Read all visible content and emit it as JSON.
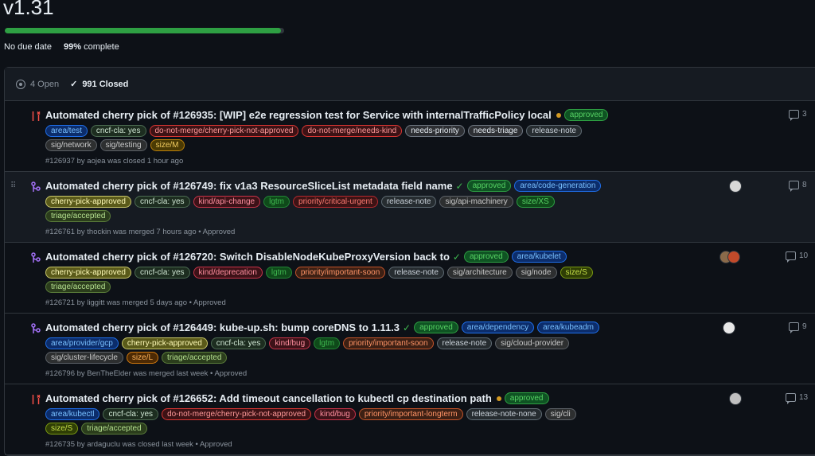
{
  "milestone": {
    "title": "v1.31",
    "progress": 0.99,
    "due": "No due date",
    "percent": "99%",
    "complete_label": "complete"
  },
  "list_header": {
    "open": "4 Open",
    "closed": "991 Closed"
  },
  "colors": {
    "closed_icon": "#f85149",
    "merged_icon": "#a371f7",
    "progress": "#2ea043"
  },
  "issues": [
    {
      "status": "closed",
      "title": "Automated cherry pick of #126935: [WIP] e2e regression test for Service with internalTrafficPolicy local",
      "check": "pending",
      "labels": [
        "approved",
        "area/test",
        "cncf-cla: yes",
        "do-not-merge/cherry-pick-not-approved",
        "do-not-merge/needs-kind",
        "needs-priority",
        "needs-triage",
        "release-note",
        "sig/network",
        "sig/testing",
        "size/M"
      ],
      "byline": "#126937 by aojea was closed 1 hour ago",
      "comments": "3"
    },
    {
      "status": "merged",
      "title": "Automated cherry pick of #126749: fix v1a3 ResourceSliceList metadata field name",
      "check": "success",
      "labels": [
        "approved",
        "area/code-generation",
        "cherry-pick-approved",
        "cncf-cla: yes",
        "kind/api-change",
        "lgtm",
        "priority/critical-urgent",
        "release-note",
        "sig/api-machinery",
        "size/XS",
        "triage/accepted"
      ],
      "byline": "#126761 by thockin was merged 7 hours ago • Approved",
      "comments": "8"
    },
    {
      "status": "merged",
      "title": "Automated cherry pick of #126720: Switch DisableNodeKubeProxyVersion back to",
      "check": "success",
      "labels": [
        "approved",
        "area/kubelet",
        "cherry-pick-approved",
        "cncf-cla: yes",
        "kind/deprecation",
        "lgtm",
        "priority/important-soon",
        "release-note",
        "sig/architecture",
        "sig/node",
        "size/S",
        "triage/accepted"
      ],
      "byline": "#126721 by liggitt was merged 5 days ago • Approved",
      "comments": "10"
    },
    {
      "status": "merged",
      "title": "Automated cherry pick of #126449: kube-up.sh: bump coreDNS to 1.11.3",
      "check": "success",
      "labels": [
        "approved",
        "area/dependency",
        "area/kubeadm",
        "area/provider/gcp",
        "cherry-pick-approved",
        "cncf-cla: yes",
        "kind/bug",
        "lgtm",
        "priority/important-soon",
        "release-note",
        "sig/cloud-provider",
        "sig/cluster-lifecycle",
        "size/L",
        "triage/accepted"
      ],
      "byline": "#126796 by BenTheElder was merged last week • Approved",
      "comments": "9"
    },
    {
      "status": "closed",
      "title": "Automated cherry pick of #126652: Add timeout cancellation to kubectl cp destination path",
      "check": "pending",
      "labels": [
        "approved",
        "area/kubectl",
        "cncf-cla: yes",
        "do-not-merge/cherry-pick-not-approved",
        "kind/bug",
        "priority/important-longterm",
        "release-note-none",
        "sig/cli",
        "size/S",
        "triage/accepted"
      ],
      "byline": "#126735 by ardaguclu was closed last week • Approved",
      "comments": "13"
    }
  ]
}
